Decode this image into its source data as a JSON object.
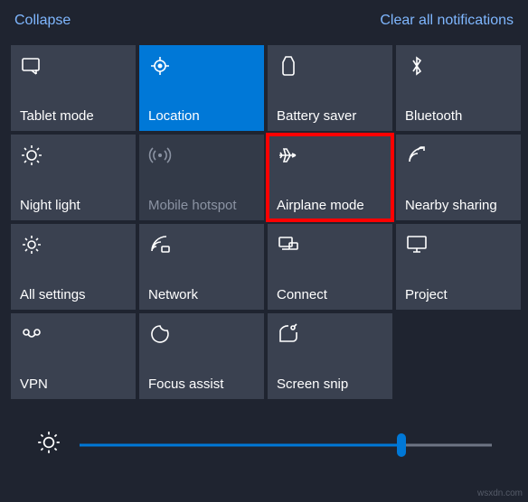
{
  "header": {
    "collapse": "Collapse",
    "clear": "Clear all notifications"
  },
  "tiles": [
    {
      "id": "tablet-mode",
      "label": "Tablet mode",
      "icon": "tablet",
      "state": "normal"
    },
    {
      "id": "location",
      "label": "Location",
      "icon": "location",
      "state": "active"
    },
    {
      "id": "battery-saver",
      "label": "Battery saver",
      "icon": "battery",
      "state": "normal"
    },
    {
      "id": "bluetooth",
      "label": "Bluetooth",
      "icon": "bluetooth",
      "state": "normal"
    },
    {
      "id": "night-light",
      "label": "Night light",
      "icon": "nightlight",
      "state": "normal"
    },
    {
      "id": "mobile-hotspot",
      "label": "Mobile hotspot",
      "icon": "hotspot",
      "state": "disabled"
    },
    {
      "id": "airplane-mode",
      "label": "Airplane mode",
      "icon": "airplane",
      "state": "highlight"
    },
    {
      "id": "nearby-sharing",
      "label": "Nearby sharing",
      "icon": "nearby",
      "state": "normal"
    },
    {
      "id": "all-settings",
      "label": "All settings",
      "icon": "settings",
      "state": "normal"
    },
    {
      "id": "network",
      "label": "Network",
      "icon": "network",
      "state": "normal"
    },
    {
      "id": "connect",
      "label": "Connect",
      "icon": "connect",
      "state": "normal"
    },
    {
      "id": "project",
      "label": "Project",
      "icon": "project",
      "state": "normal"
    },
    {
      "id": "vpn",
      "label": "VPN",
      "icon": "vpn",
      "state": "normal"
    },
    {
      "id": "focus-assist",
      "label": "Focus assist",
      "icon": "focus",
      "state": "normal"
    },
    {
      "id": "screen-snip",
      "label": "Screen snip",
      "icon": "snip",
      "state": "normal"
    }
  ],
  "brightness": {
    "value": 78
  },
  "watermark": "wsxdn.com"
}
